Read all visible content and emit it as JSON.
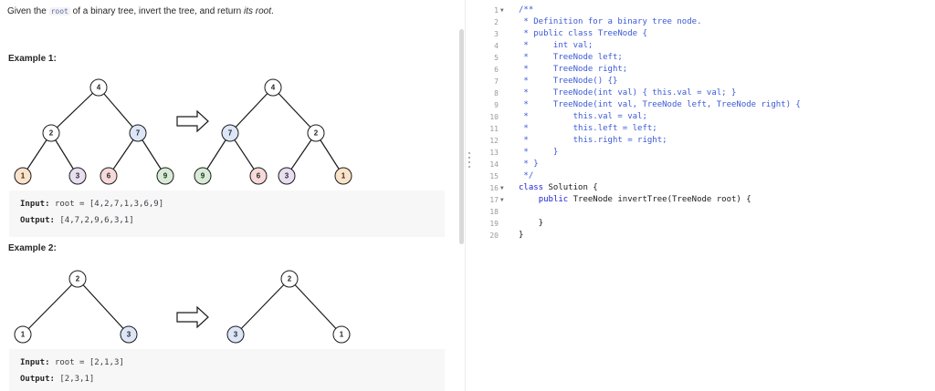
{
  "problem": {
    "description_before": "Given the ",
    "description_code": "root",
    "description_middle": " of a binary tree, invert the tree, and return ",
    "description_emph": "its root",
    "description_end": "."
  },
  "examples": [
    {
      "heading": "Example 1:",
      "input_label": "Input:",
      "input_value": "root = [4,2,7,1,3,6,9]",
      "output_label": "Output:",
      "output_value": "[4,7,2,9,6,3,1]",
      "before_tree": [
        "4",
        "2",
        "7",
        "1",
        "3",
        "6",
        "9"
      ],
      "after_tree": [
        "4",
        "7",
        "2",
        "9",
        "6",
        "3",
        "1"
      ]
    },
    {
      "heading": "Example 2:",
      "input_label": "Input:",
      "input_value": "root = [2,1,3]",
      "output_label": "Output:",
      "output_value": "[2,3,1]",
      "before_tree": [
        "2",
        "1",
        "3"
      ],
      "after_tree": [
        "2",
        "3",
        "1"
      ]
    }
  ],
  "node_colors": {
    "default": "#ffffff",
    "green": "#d7ecd6",
    "blue": "#dce6f7",
    "purple": "#e7def0",
    "red": "#f6d9d8",
    "orange": "#fbe2c9"
  },
  "icons": {
    "arrow": "right-arrow-icon"
  },
  "editor": {
    "line_numbers": [
      "1",
      "2",
      "3",
      "4",
      "5",
      "6",
      "7",
      "8",
      "9",
      "10",
      "11",
      "12",
      "13",
      "14",
      "15",
      "16",
      "17",
      "18",
      "19",
      "20"
    ],
    "fold_markers": {
      "1": "▼",
      "16": "▼",
      "17": "▼"
    },
    "lines": [
      "/**",
      " * Definition for a binary tree node.",
      " * public class TreeNode {",
      " *     int val;",
      " *     TreeNode left;",
      " *     TreeNode right;",
      " *     TreeNode() {}",
      " *     TreeNode(int val) { this.val = val; }",
      " *     TreeNode(int val, TreeNode left, TreeNode right) {",
      " *         this.val = val;",
      " *         this.left = left;",
      " *         this.right = right;",
      " *     }",
      " * }",
      " */",
      "class Solution {",
      "    public TreeNode invertTree(TreeNode root) {",
      "",
      "    }",
      "}"
    ],
    "line_kinds": [
      "comment",
      "comment",
      "comment",
      "comment",
      "comment",
      "comment",
      "comment",
      "comment",
      "comment",
      "comment",
      "comment",
      "comment",
      "comment",
      "comment",
      "comment",
      "code",
      "code",
      "code",
      "code",
      "code"
    ]
  }
}
